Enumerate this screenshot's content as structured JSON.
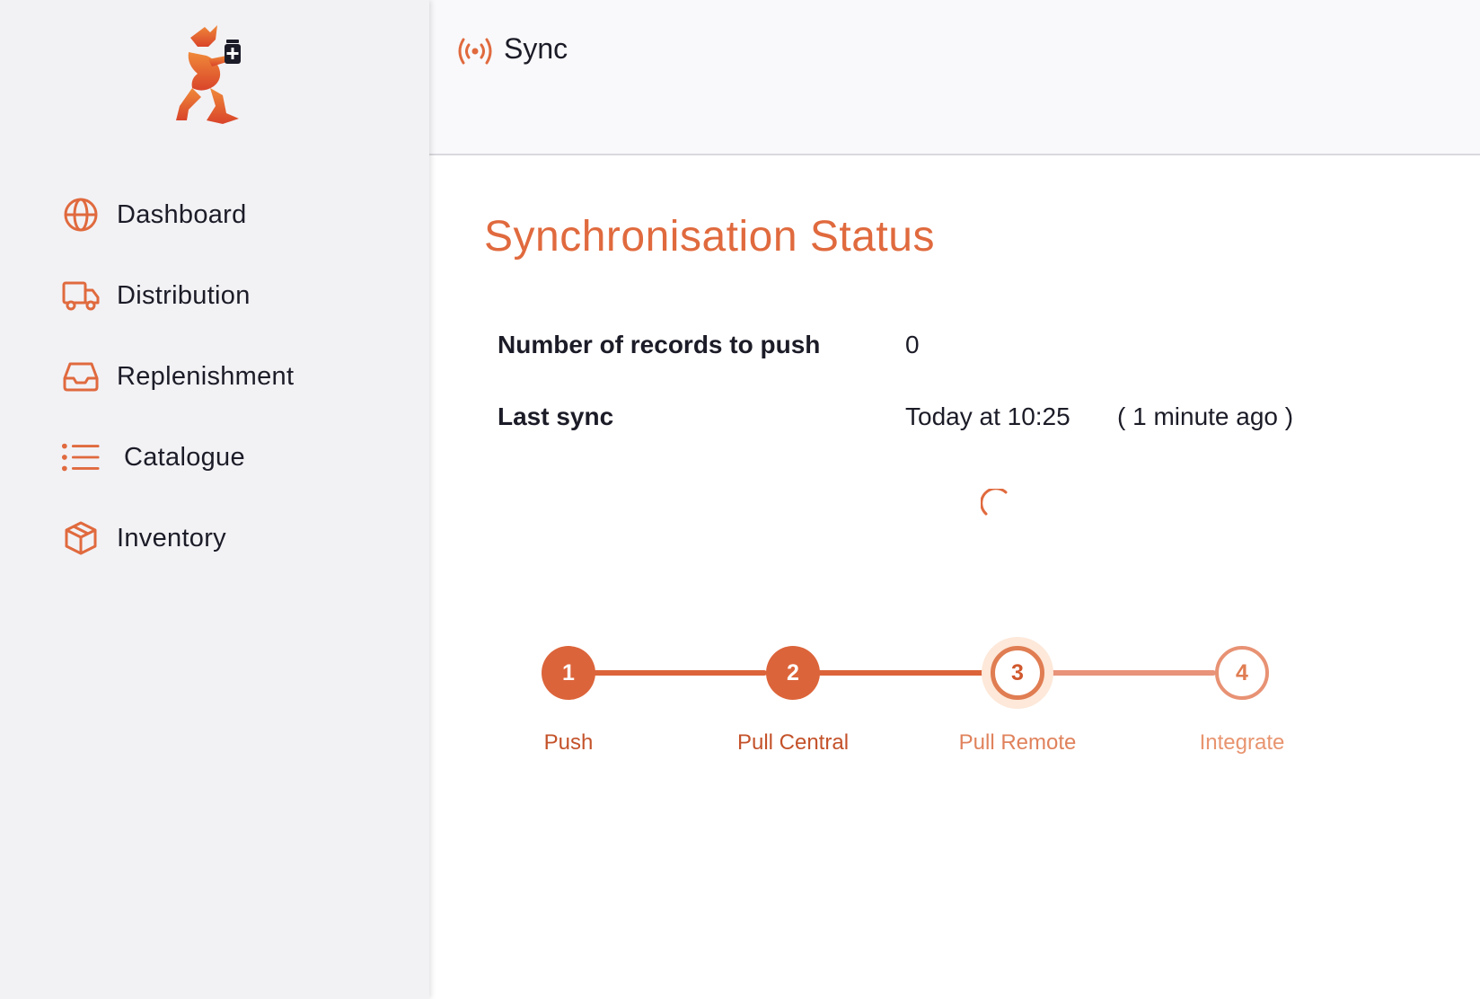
{
  "app": {
    "accent_color": "#e06a3e"
  },
  "sidebar": {
    "logo": "logo-icon",
    "items": [
      {
        "label": "Dashboard",
        "icon": "globe-icon"
      },
      {
        "label": "Distribution",
        "icon": "truck-icon"
      },
      {
        "label": "Replenishment",
        "icon": "inbox-icon"
      },
      {
        "label": "Catalogue",
        "icon": "list-icon"
      },
      {
        "label": "Inventory",
        "icon": "box-icon"
      }
    ]
  },
  "header": {
    "title": "Sync",
    "icon": "broadcast-icon"
  },
  "main": {
    "title": "Synchronisation Status",
    "records_to_push": {
      "label": "Number of records to push",
      "value": "0"
    },
    "last_sync": {
      "label": "Last sync",
      "value": "Today at 10:25",
      "relative": "( 1 minute ago )"
    },
    "spinner": "loading-spinner",
    "steps": [
      {
        "number": "1",
        "label": "Push",
        "state": "done"
      },
      {
        "number": "2",
        "label": "Pull Central",
        "state": "done"
      },
      {
        "number": "3",
        "label": "Pull Remote",
        "state": "active"
      },
      {
        "number": "4",
        "label": "Integrate",
        "state": "pending"
      }
    ]
  }
}
